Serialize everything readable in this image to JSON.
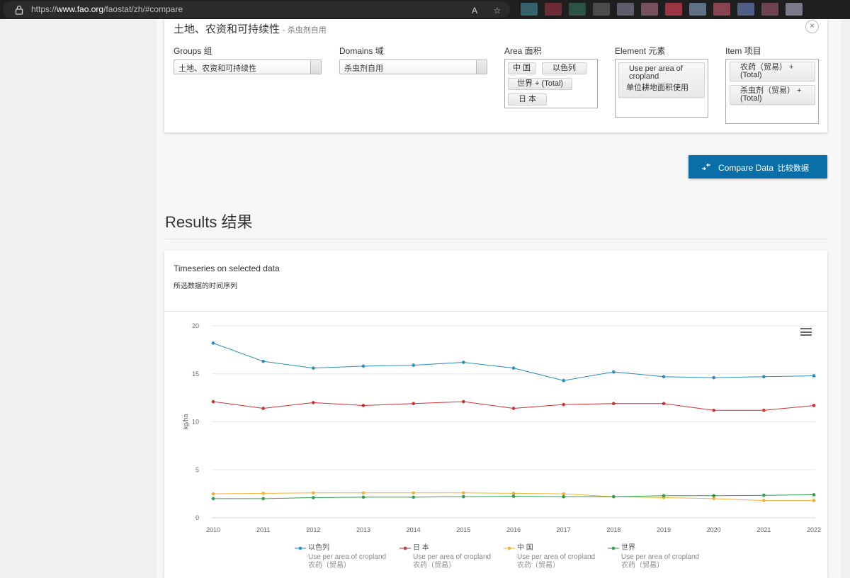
{
  "browser": {
    "url_prefix": "https://",
    "url_host": "www.fao.org",
    "url_path": "/faostat/zh/#compare"
  },
  "selection": {
    "title": "土地、农资和可持续性",
    "subtitle": "- 杀虫剂自用",
    "close_label": "×",
    "groups": {
      "label": "Groups  组",
      "value": "土地、农资和可持续性"
    },
    "domains": {
      "label": "Domains  域",
      "value": "杀虫剂自用"
    },
    "area": {
      "label": "Area  面积",
      "tags": [
        "中 国",
        "以色列",
        "世界 + (Total)",
        "日 本"
      ]
    },
    "element": {
      "label": "Element  元素",
      "tag_line1": "Use per area of",
      "tag_line2": "cropland",
      "tag_line3": "单位耕地面积使用"
    },
    "item": {
      "label": "Item  项目",
      "tags": [
        {
          "line1": "农药（贸易）   +",
          "line2": "(Total)"
        },
        {
          "line1": "杀虫剂（贸易）   +",
          "line2": "(Total)"
        }
      ]
    }
  },
  "compare_button": {
    "label": "Compare Data",
    "label_zh": "比较数据"
  },
  "results": {
    "title": "Results  结果"
  },
  "chart_card": {
    "title": "Timeseries on selected data",
    "subtitle": "所选数据的时间序列"
  },
  "chart_data": {
    "type": "line",
    "title": "",
    "xlabel": "",
    "ylabel": "kg/ha",
    "ylim": [
      0,
      20
    ],
    "yticks": [
      "0",
      "5",
      "10",
      "15",
      "20"
    ],
    "categories": [
      "2010",
      "2011",
      "2012",
      "2013",
      "2014",
      "2015",
      "2016",
      "2017",
      "2018",
      "2019",
      "2020",
      "2021",
      "2022"
    ],
    "grid": true,
    "legend_position": "bottom",
    "series": [
      {
        "name": "以色列",
        "color": "#2b8cbe",
        "element": "Use per area of cropland",
        "item": "农药（贸易）",
        "values": [
          18.2,
          16.3,
          15.6,
          15.8,
          15.9,
          16.2,
          15.6,
          14.3,
          15.2,
          14.7,
          14.6,
          14.7,
          14.8
        ]
      },
      {
        "name": "日 本",
        "color": "#cc3333",
        "element": "Use per area of cropland",
        "item": "农药（贸易）",
        "values": [
          12.1,
          11.4,
          12.0,
          11.7,
          11.9,
          12.1,
          11.4,
          11.8,
          11.9,
          11.9,
          11.2,
          11.2,
          11.7
        ]
      },
      {
        "name": "中 国",
        "color": "#f2b134",
        "element": "Use per area of cropland",
        "item": "农药（贸易）",
        "values": [
          2.5,
          2.55,
          2.6,
          2.6,
          2.6,
          2.6,
          2.55,
          2.5,
          2.2,
          2.1,
          2.0,
          1.8,
          1.8
        ]
      },
      {
        "name": "世界",
        "color": "#2e9e4e",
        "element": "Use per area of cropland",
        "item": "农药（贸易）",
        "values": [
          2.0,
          2.0,
          2.1,
          2.15,
          2.15,
          2.2,
          2.25,
          2.2,
          2.2,
          2.3,
          2.3,
          2.35,
          2.4
        ]
      }
    ]
  },
  "icons": {
    "lock": "lock-icon",
    "menu": "hamburger-menu-icon",
    "compare": "compare-arrows-icon"
  }
}
